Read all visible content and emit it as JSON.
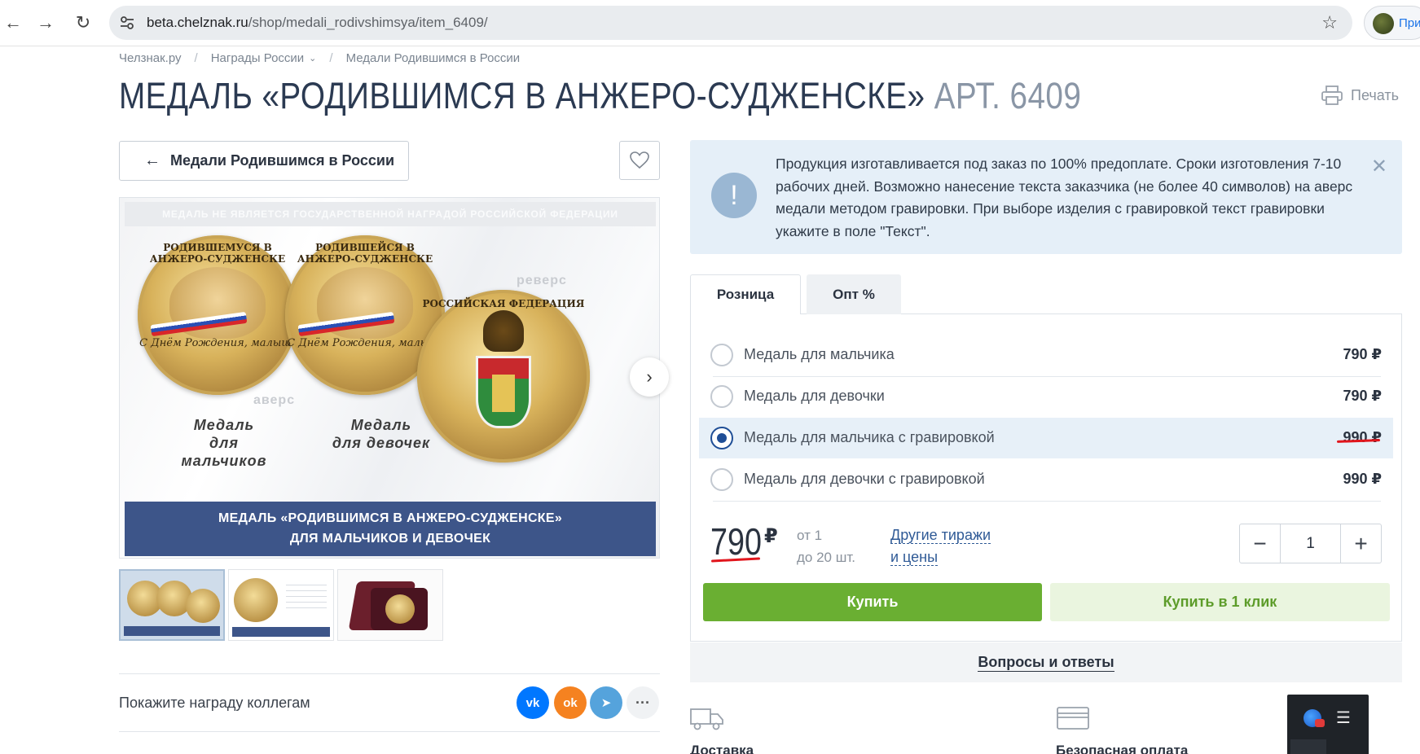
{
  "browser": {
    "url_host": "beta.chelznak.ru",
    "url_path": "/shop/medali_rodivshimsya/item_6409/",
    "profile_label": "При"
  },
  "breadcrumbs": [
    "Челзнак.ру",
    "Награды России",
    "Медали Родившимся в России"
  ],
  "product": {
    "title": "МЕДАЛЬ «РОДИВШИМСЯ В АНЖЕРО-СУДЖЕНСКЕ»",
    "article": "АРТ. 6409",
    "print_label": "Печать",
    "back_label": "Медали Родившимся в России"
  },
  "gallery": {
    "top_notice": "МЕДАЛЬ НЕ ЯВЛЯЕТСЯ ГОСУДАРСТВЕННОЙ НАГРАДОЙ РОССИЙСКОЙ ФЕДЕРАЦИИ",
    "medal_ring_boy": "РОДИВШЕМУСЯ В АНЖЕРО-СУДЖЕНСКЕ",
    "medal_ring_girl": "РОДИВШЕЙСЯ В АНЖЕРО-СУДЖЕНСКЕ",
    "medal_script": "С Днём Рождения, малыш!",
    "reverse_ring": "РОССИЙСКАЯ ФЕДЕРАЦИЯ",
    "label_reverse": "реверс",
    "label_obverse": "аверс",
    "label_boys": "Медаль\nдля мальчиков",
    "label_girls": "Медаль\nдля девочек",
    "banner_line1": "МЕДАЛЬ «РОДИВШИМСЯ В АНЖЕРО-СУДЖЕНСКЕ»",
    "banner_line2": "ДЛЯ МАЛЬЧИКОВ И ДЕВОЧЕК"
  },
  "share": {
    "label": "Покажите награду коллегам",
    "buttons": [
      {
        "name": "vk",
        "text": "vk",
        "color": "#0077ff"
      },
      {
        "name": "ok",
        "text": "ok",
        "color": "#f58220"
      },
      {
        "name": "telegram",
        "text": "➤",
        "color": "#55a3dc"
      },
      {
        "name": "more",
        "text": "···",
        "color": "#f0f2f4"
      }
    ]
  },
  "notice": {
    "text": "Продукция изготавливается под заказ по 100% предоплате. Сроки изготовления 7-10 рабочих дней. Возможно нанесение текста заказчика (не более 40 символов) на аверс медали методом гравировки. При выборе изделия с гравировкой текст гравировки укажите в поле \"Текст\"."
  },
  "tabs": [
    {
      "label": "Розница",
      "active": true
    },
    {
      "label": "Опт %",
      "active": false
    }
  ],
  "options": [
    {
      "label": "Медаль для мальчика",
      "price": "790 ₽",
      "selected": false
    },
    {
      "label": "Медаль для девочки",
      "price": "790 ₽",
      "selected": false
    },
    {
      "label": "Медаль для мальчика с гравировкой",
      "price": "990 ₽",
      "selected": true
    },
    {
      "label": "Медаль для девочки с гравировкой",
      "price": "990 ₽",
      "selected": false
    }
  ],
  "pricing": {
    "price": "790",
    "currency": "₽",
    "tier_line1": "от 1",
    "tier_line2": "до 20 шт.",
    "other_line1": "Другие тиражи",
    "other_line2": "и цены"
  },
  "quantity": {
    "minus": "−",
    "value": "1",
    "plus": "+"
  },
  "actions": {
    "buy": "Купить",
    "buy_one_click": "Купить в 1 клик",
    "qa": "Вопросы и ответы"
  },
  "features": [
    {
      "icon": "truck-icon",
      "label": "Доставка"
    },
    {
      "icon": "card-icon",
      "label": "Безопасная оплата"
    }
  ],
  "colors": {
    "accent_green": "#6aaf32",
    "brand_blue": "#3d5589",
    "annotation_red": "#e1151c"
  }
}
